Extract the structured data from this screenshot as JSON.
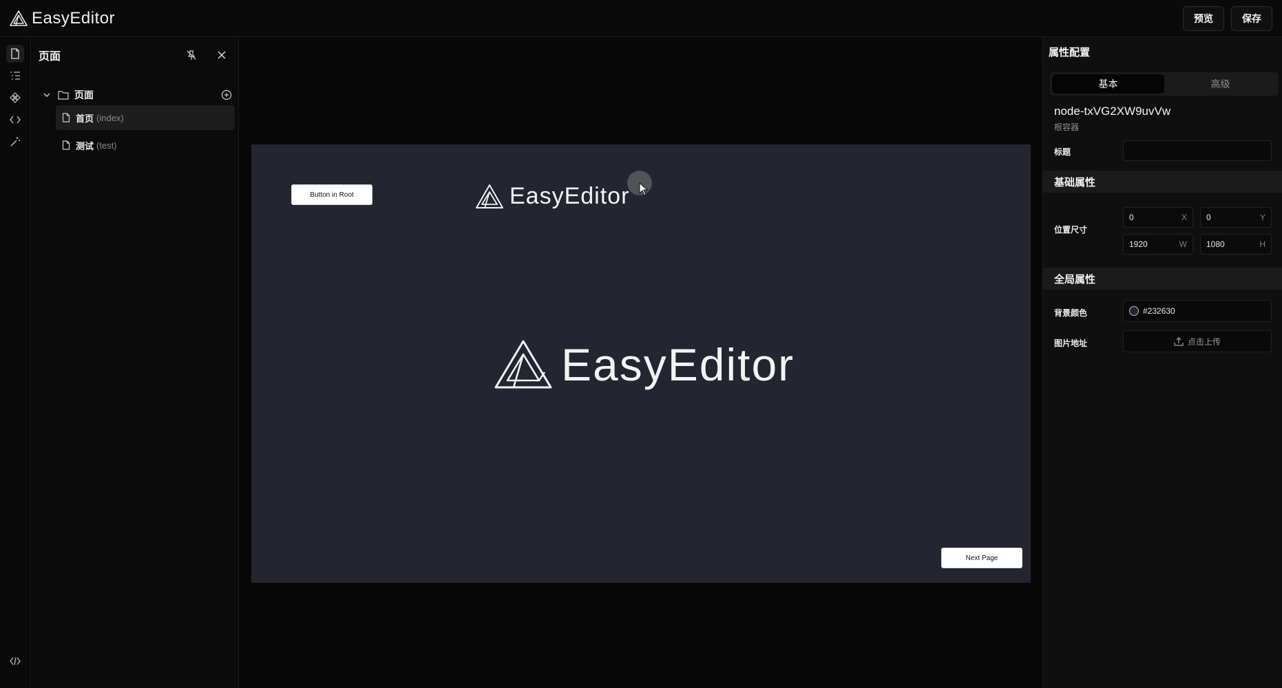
{
  "app": {
    "brand": "EasyEditor"
  },
  "header": {
    "preview_label": "预览",
    "save_label": "保存"
  },
  "iconbar": {
    "items": [
      {
        "icon": "file-icon",
        "active": true
      },
      {
        "icon": "outline-list-icon",
        "active": false
      },
      {
        "icon": "components-icon",
        "active": false
      },
      {
        "icon": "code-icon",
        "active": false
      },
      {
        "icon": "magic-wand-icon",
        "active": false
      }
    ],
    "bottom_icon": "code-slash-icon"
  },
  "left_panel": {
    "title": "页面",
    "tree": {
      "root_label": "页面",
      "pages": [
        {
          "name": "首页",
          "path": "(index)",
          "active": true
        },
        {
          "name": "测试",
          "path": "(test)",
          "active": false
        }
      ]
    }
  },
  "canvas": {
    "background": "#232630",
    "button_root_label": "Button in Root",
    "next_page_label": "Next Page",
    "logo_small_text": "EasyEditor",
    "logo_large_text": "EasyEditor"
  },
  "right_panel": {
    "title": "属性配置",
    "tabs": [
      "基本",
      "高级"
    ],
    "active_tab": "基本",
    "node_id": "node-txVG2XW9uvVw",
    "node_type": "根容器",
    "title_label": "标题",
    "title_value": "",
    "basic_section": "基础属性",
    "position_label": "位置尺寸",
    "x": {
      "value": "0",
      "unit": "X"
    },
    "y": {
      "value": "0",
      "unit": "Y"
    },
    "w": {
      "value": "1920",
      "unit": "W"
    },
    "h": {
      "value": "1080",
      "unit": "H"
    },
    "global_section": "全局属性",
    "bg_color_label": "背景颜色",
    "bg_color_value": "#232630",
    "image_label": "图片地址",
    "upload_label": "点击上传"
  }
}
